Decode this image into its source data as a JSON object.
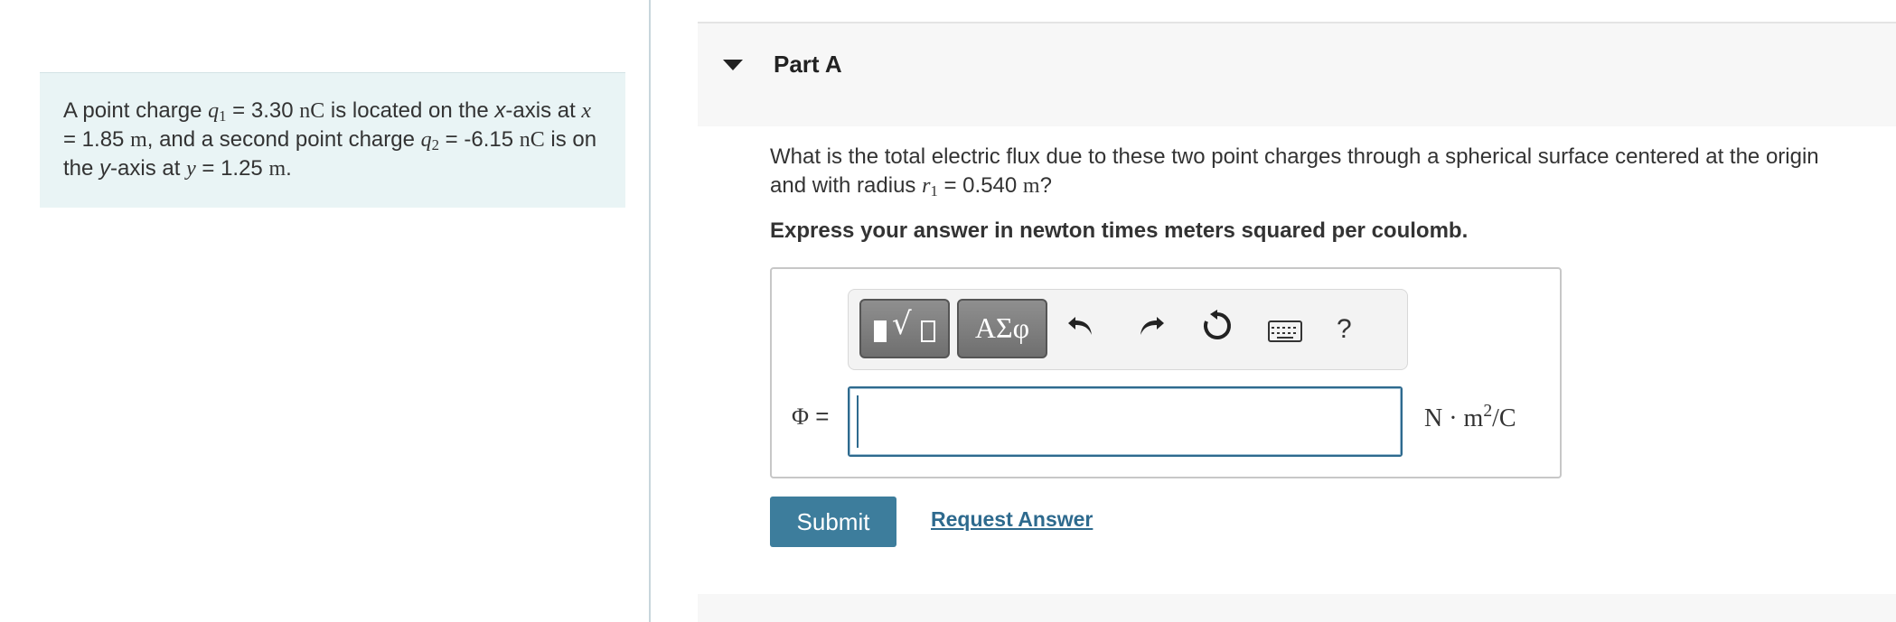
{
  "statement": {
    "t1": "A point charge ",
    "q1_sym": "q",
    "q1_sub": "1",
    "t2": " = 3.30 ",
    "t3_unit": "nC",
    "t4": " is located on the ",
    "t5_x": "x",
    "t6": "-axis at ",
    "t7_xvar": "x",
    "t8": " = 1.85 ",
    "t9_unit": "m",
    "t10": ", and a second point charge ",
    "q2_sym": "q",
    "q2_sub": "2",
    "t11": " = -6.15 ",
    "t12_unit": "nC",
    "t13": " is on the ",
    "t14_y": "y",
    "t15": "-axis at ",
    "t16_yvar": "y",
    "t17": " = 1.25 ",
    "t18_unit": "m",
    "t19": "."
  },
  "part": {
    "title": "Part A"
  },
  "question": {
    "t1": "What is the total electric flux due to these two point charges through a spherical surface centered at the origin and with radius ",
    "r_sym": "r",
    "r_sub": "1",
    "t2": " = 0.540 ",
    "t3_unit": "m",
    "t4": "?"
  },
  "instruction": "Express your answer in newton times meters squared per coulomb.",
  "toolbar": {
    "greek_label": "ΑΣφ",
    "help_label": "?"
  },
  "answer": {
    "label": "Φ",
    "equals": " =",
    "value": "",
    "units_base": "N · m",
    "units_exp": "2",
    "units_tail": "/C"
  },
  "actions": {
    "submit_label": "Submit",
    "request_label": "Request Answer"
  }
}
